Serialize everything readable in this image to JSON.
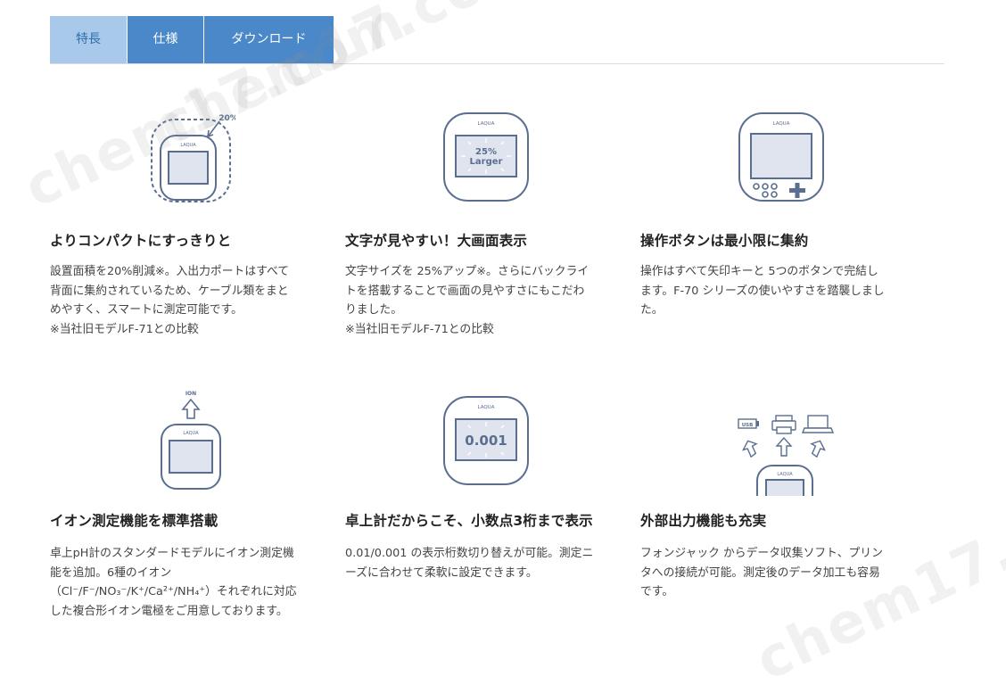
{
  "tabs": [
    {
      "label": "特長",
      "active": true
    },
    {
      "label": "仕様",
      "active": false
    },
    {
      "label": "ダウンロード",
      "active": false
    }
  ],
  "colors": {
    "tab": "#4a88c9",
    "tab_active": "#a9c9ea",
    "device_stroke": "#5a6e8f",
    "screen_fill": "#dfe4ef"
  },
  "watermark": "chem17.com",
  "features": [
    {
      "icon": "compact-device-icon",
      "badge": "20%",
      "title": "よりコンパクトにすっきりと",
      "body": [
        "設置面積を20%削減※。入出力ポートはすべて",
        "背面に集約されているため、ケーブル類をまと",
        "めやすく、スマートに測定可能です。",
        "※当社旧モデルF-71との比較"
      ]
    },
    {
      "icon": "large-screen-device-icon",
      "device_label": "LAQUA",
      "screen_text": [
        "25%",
        "Larger"
      ],
      "title": "文字が見やすい！大画面表示",
      "body": [
        "文字サイズを 25%アップ※。さらにバックライ",
        "トを搭載することで画面の見やすさにもこだわ",
        "りました。",
        "※当社旧モデルF-71との比較"
      ]
    },
    {
      "icon": "buttons-device-icon",
      "device_label": "LAQUA",
      "title": "操作ボタンは最小限に集約",
      "body": [
        "操作はすべて矢印キーと 5つのボタンで完結し",
        "ます。F-70 シリーズの使いやすさを踏襲しまし",
        "た。"
      ]
    },
    {
      "icon": "ion-device-icon",
      "badge": "ION",
      "device_label": "LAQUA",
      "title": "イオン測定機能を標準搭載",
      "body": [
        "卓上pH計のスタンダードモデルにイオン測定機",
        "能を追加。6種のイオン",
        "（Cl⁻/F⁻/NO₃⁻/K⁺/Ca²⁺/NH₄⁺）それぞれに対応",
        "した複合形イオン電極をご用意しております。"
      ]
    },
    {
      "icon": "decimal-device-icon",
      "device_label": "LAQUA",
      "screen_text": [
        "0.001"
      ],
      "title": "卓上計だからこそ、小数点3桁まで表示",
      "body": [
        "0.01/0.001 の表示桁数切り替えが可能。測定ニ",
        "ーズに合わせて柔軟に設定できます。"
      ]
    },
    {
      "icon": "output-device-icon",
      "badge": "USB",
      "device_label": "LAQUA",
      "title": "外部出力機能も充実",
      "body": [
        "フォンジャック からデータ収集ソフト、プリン",
        "タへの接続が可能。測定後のデータ加工も容易",
        "です。"
      ]
    }
  ]
}
